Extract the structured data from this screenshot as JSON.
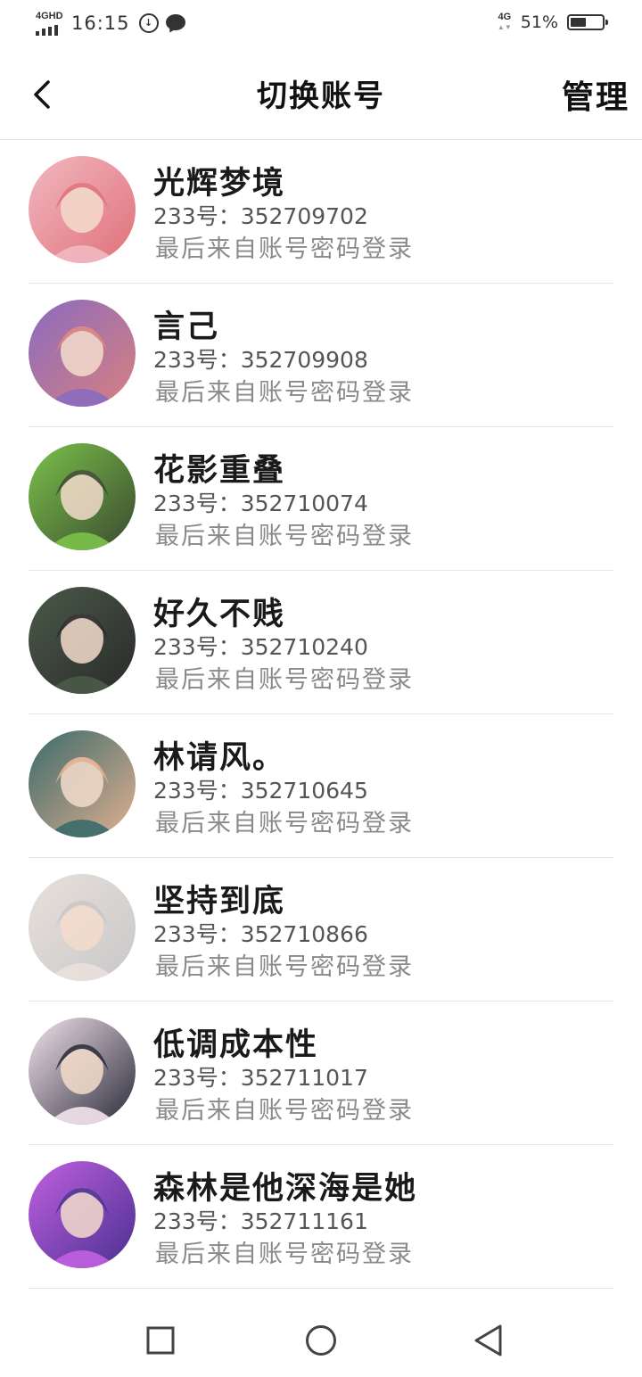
{
  "status_bar": {
    "network_left": "4GHD",
    "time": "16:15",
    "network_right": "4G",
    "battery_percent": "51%",
    "battery_level": 0.51
  },
  "header": {
    "title": "切换账号",
    "manage_label": "管理",
    "back_icon": "chevron-left-icon"
  },
  "accounts": [
    {
      "name": "光辉梦境",
      "id_text": "233号：352709702",
      "last_login": "最后来自账号密码登录",
      "avatar_colors": [
        "#f2b8c0",
        "#e0707a"
      ]
    },
    {
      "name": "言己",
      "id_text": "233号：352709908",
      "last_login": "最后来自账号密码登录",
      "avatar_colors": [
        "#8a6bc0",
        "#d88080"
      ]
    },
    {
      "name": "花影重叠",
      "id_text": "233号：352710074",
      "last_login": "最后来自账号密码登录",
      "avatar_colors": [
        "#7cc24a",
        "#3a4a30"
      ]
    },
    {
      "name": "好久不贱",
      "id_text": "233号：352710240",
      "last_login": "最后来自账号密码登录",
      "avatar_colors": [
        "#4a5a48",
        "#2a2a2a"
      ]
    },
    {
      "name": "林请风。",
      "id_text": "233号：352710645",
      "last_login": "最后来自账号密码登录",
      "avatar_colors": [
        "#3a6a6a",
        "#e0b090"
      ]
    },
    {
      "name": "坚持到底",
      "id_text": "233号：352710866",
      "last_login": "最后来自账号密码登录",
      "avatar_colors": [
        "#e8e0dc",
        "#c8c8c8"
      ]
    },
    {
      "name": "低调成本性",
      "id_text": "233号：352711017",
      "last_login": "最后来自账号密码登录",
      "avatar_colors": [
        "#f4e4ec",
        "#2a2a3a"
      ]
    },
    {
      "name": "森林是他深海是她",
      "id_text": "233号：352711161",
      "last_login": "最后来自账号密码登录",
      "avatar_colors": [
        "#c060e0",
        "#4a3090"
      ]
    }
  ],
  "nav": {
    "recent_icon": "square-icon",
    "home_icon": "circle-icon",
    "back_icon": "triangle-back-icon"
  }
}
